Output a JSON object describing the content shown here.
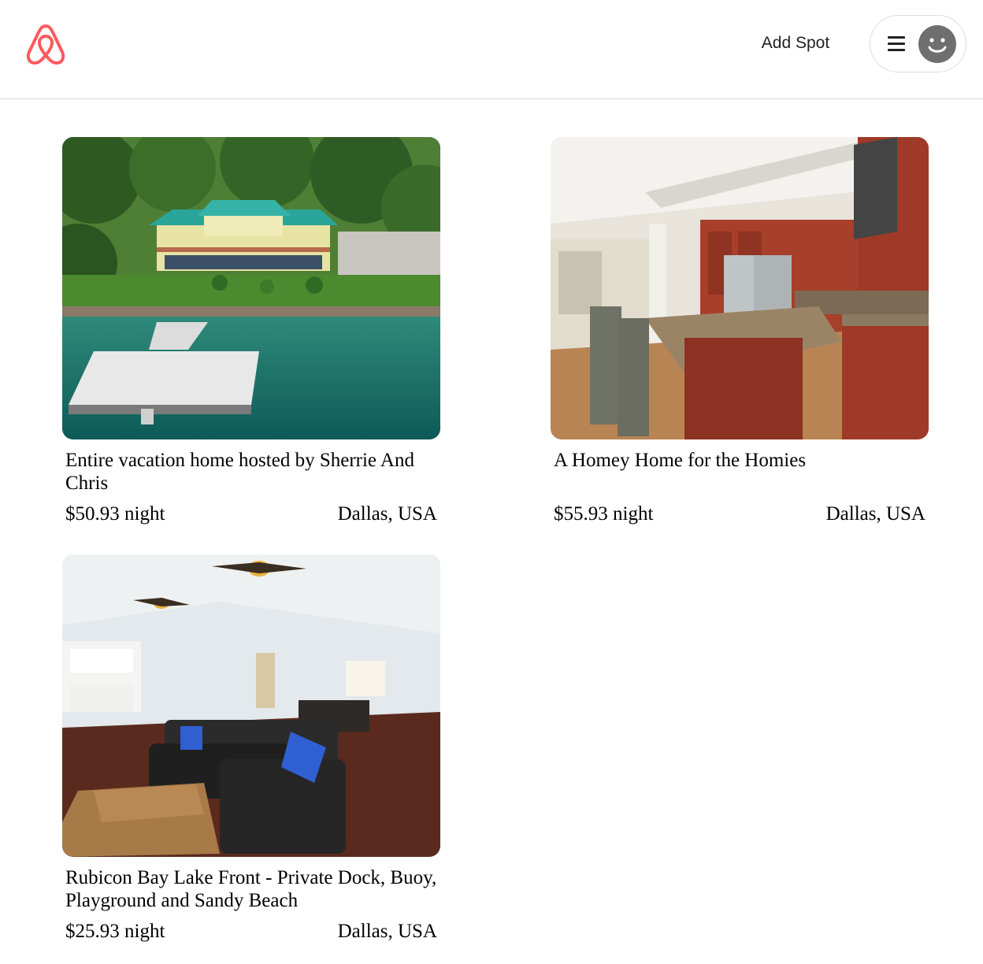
{
  "header": {
    "add_spot_label": "Add Spot",
    "logo_icon": "airbnb-logo-icon",
    "menu_icon": "hamburger-menu-icon",
    "avatar_icon": "user-avatar-icon",
    "brand_color": "#FF5A5F"
  },
  "listings": [
    {
      "title": "Entire vacation home hosted by Sherrie And Chris",
      "price": "$50.93 night",
      "location": "Dallas, USA",
      "image": "lakefront-house-with-dock"
    },
    {
      "title": "A Homey Home for the Homies",
      "price": "$55.93 night",
      "location": "Dallas, USA",
      "image": "kitchen-with-red-cabinets"
    },
    {
      "title": "Rubicon Bay Lake Front - Private Dock, Buoy, Playground and Sandy Beach",
      "price": "$25.93 night",
      "location": "Dallas, USA",
      "image": "living-room-with-sofa"
    }
  ]
}
